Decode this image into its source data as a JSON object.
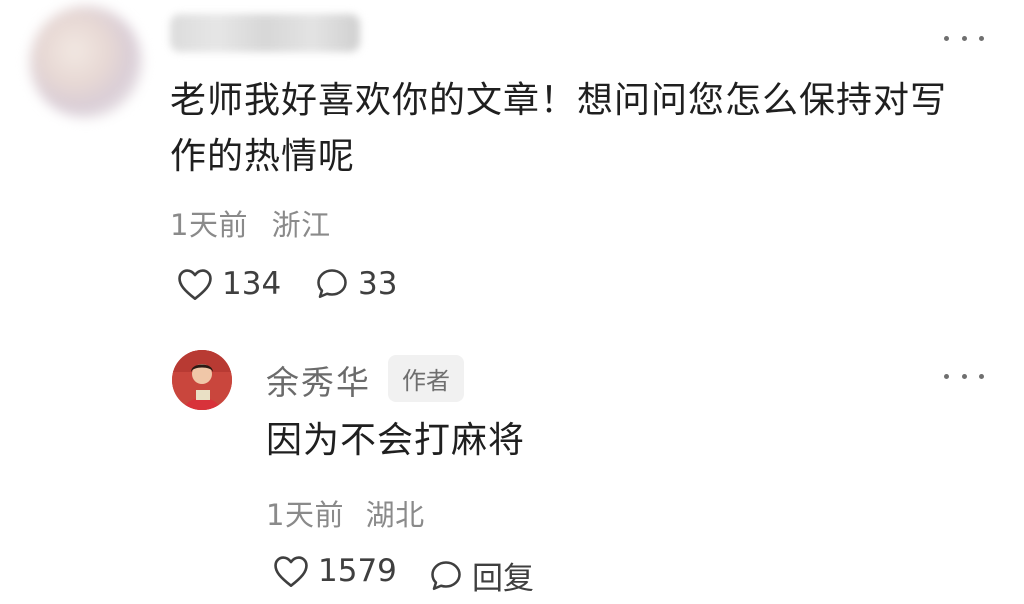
{
  "comment": {
    "text": "老师我好喜欢你的文章！想问问您怎么保持对写作的热情呢",
    "text_line1": "老师我好喜欢你的文章！想问问您怎么保持对写",
    "text_line2": "作的热情呢",
    "time": "1天前",
    "location": "浙江",
    "likes": "134",
    "comments": "33"
  },
  "reply": {
    "author": "余秀华",
    "badge": "作者",
    "text": "因为不会打麻将",
    "time": "1天前",
    "location": "湖北",
    "likes": "1579",
    "reply_label": "回复"
  },
  "colors": {
    "text": "#1f1f1f",
    "meta": "#8a8a8a",
    "icon": "#3f3f3f",
    "badge_bg": "#f1f1f1"
  },
  "icons": [
    "heart-outline",
    "comment-bubble",
    "more-dots"
  ]
}
